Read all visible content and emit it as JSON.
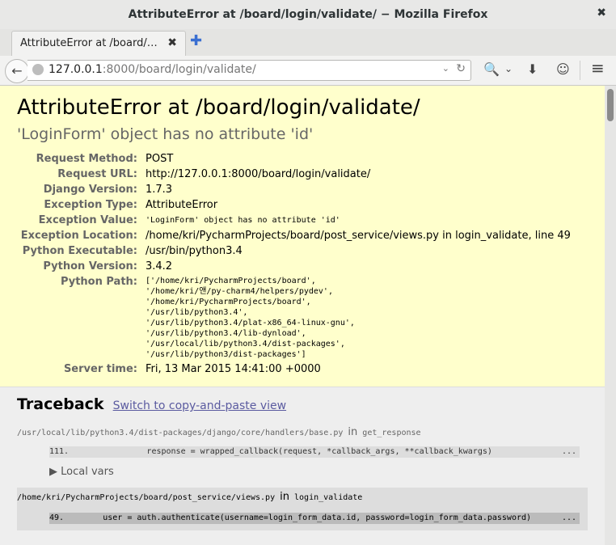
{
  "window": {
    "title": "AttributeError at /board/login/validate/ − Mozilla Firefox",
    "close_glyph": "✖"
  },
  "tab": {
    "title": "AttributeError at /board/…",
    "close_glyph": "✖",
    "new_tab_glyph": "✚"
  },
  "navbar": {
    "back_glyph": "←",
    "url_host": "127.0.0.1",
    "url_rest": ":8000/board/login/validate/",
    "dropdown_glyph": "⌄",
    "reload_glyph": "↻",
    "search_glyph": "🔍",
    "search_drop_glyph": "⌄",
    "download_glyph": "⬇",
    "hello_glyph": "☺",
    "menu_glyph": "≡"
  },
  "error": {
    "title": "AttributeError at /board/login/validate/",
    "value": "'LoginForm' object has no attribute 'id'",
    "meta": [
      {
        "label": "Request Method:",
        "value": "POST"
      },
      {
        "label": "Request URL:",
        "value": "http://127.0.0.1:8000/board/login/validate/"
      },
      {
        "label": "Django Version:",
        "value": "1.7.3"
      },
      {
        "label": "Exception Type:",
        "value": "AttributeError"
      },
      {
        "label": "Exception Value:",
        "value": "'LoginForm' object has no attribute 'id'"
      },
      {
        "label": "Exception Location:",
        "value": "/home/kri/PycharmProjects/board/post_service/views.py in login_validate, line 49"
      },
      {
        "label": "Python Executable:",
        "value": "/usr/bin/python3.4"
      },
      {
        "label": "Python Version:",
        "value": "3.4.2"
      },
      {
        "label": "Python Path:",
        "value": ""
      },
      {
        "label": "Server time:",
        "value": "Fri, 13 Mar 2015 14:41:00 +0000"
      }
    ],
    "python_path": [
      "['/home/kri/PycharmProjects/board',",
      " '/home/kri/앤/py-charm4/helpers/pydev',",
      " '/home/kri/PycharmProjects/board',",
      " '/usr/lib/python3.4',",
      " '/usr/lib/python3.4/plat-x86_64-linux-gnu',",
      " '/usr/lib/python3.4/lib-dynload',",
      " '/usr/local/lib/python3.4/dist-packages',",
      " '/usr/lib/python3/dist-packages']"
    ]
  },
  "traceback": {
    "title": "Traceback",
    "switch_link": "Switch to copy-and-paste view",
    "in_word": "in",
    "frames": [
      {
        "file": "/usr/local/lib/python3.4/dist-packages/django/core/handlers/base.py",
        "function": "get_response",
        "line_no": "111.",
        "code": "                response = wrapped_callback(request, *callback_args, **callback_kwargs)",
        "dots": "...",
        "locals_label": "▶ Local vars"
      },
      {
        "file": "/home/kri/PycharmProjects/board/post_service/views.py",
        "function": "login_validate",
        "line_no": "49.",
        "code": "        user = auth.authenticate(username=login_form_data.id, password=login_form_data.password)",
        "dots": "..."
      }
    ]
  }
}
